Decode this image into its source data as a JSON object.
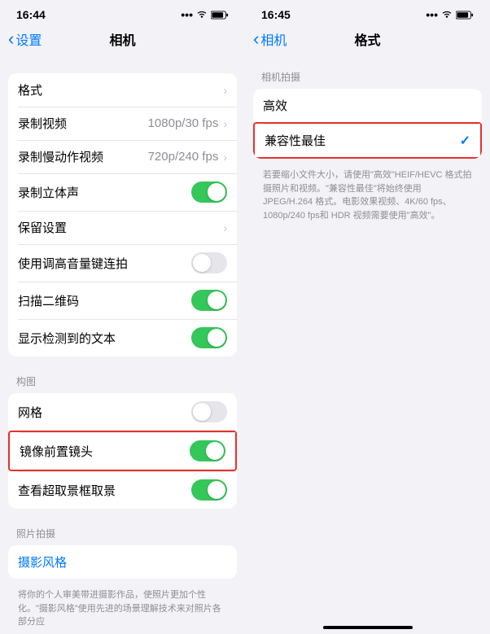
{
  "left": {
    "status_time": "16:44",
    "back_label": "设置",
    "title": "相机",
    "rows": {
      "formats": "格式",
      "record_video": "录制视频",
      "record_video_detail": "1080p/30 fps",
      "record_slomo": "录制慢动作视频",
      "record_slomo_detail": "720p/240 fps",
      "record_stereo": "录制立体声",
      "preserve": "保留设置",
      "volume_burst": "使用调高音量键连拍",
      "scan_qr": "扫描二维码",
      "detect_text": "显示检测到的文本",
      "grid": "网格",
      "mirror_front": "镜像前置镜头",
      "view_outside": "查看超取景框取景",
      "photo_styles": "摄影风格"
    },
    "sections": {
      "composition": "构图",
      "photo_capture": "照片拍摄"
    },
    "footer_photo": "将你的个人审美带进摄影作品，使照片更加个性化。\"摄影风格\"使用先进的场景理解技术来对照片各部分应"
  },
  "right": {
    "status_time": "16:45",
    "back_label": "相机",
    "title": "格式",
    "section_capture": "相机拍摄",
    "rows": {
      "high_efficiency": "高效",
      "most_compatible": "兼容性最佳"
    },
    "footer": "若要缩小文件大小，请使用\"高效\"HEIF/HEVC 格式拍摄照片和视频。\"兼容性最佳\"将始终使用 JPEG/H.264 格式。电影效果视频、4K/60 fps、1080p/240 fps和 HDR 视频需要使用\"高效\"。"
  }
}
